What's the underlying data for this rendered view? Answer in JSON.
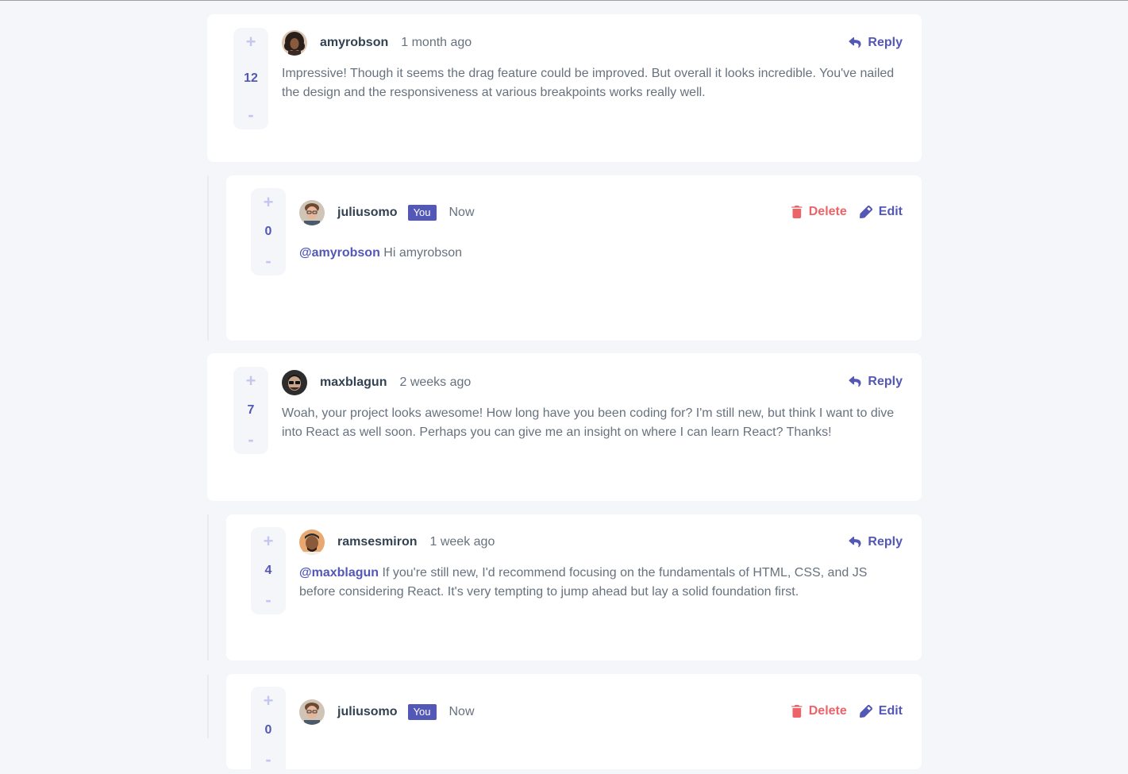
{
  "comments": [
    {
      "score": "12",
      "username": "amyrobson",
      "you": false,
      "time": "1 month ago",
      "mention": "",
      "text": "Impressive! Though it seems the drag feature could be improved. But overall it looks incredible. You've nailed the design and the responsiveness at various breakpoints works really well.",
      "actions": {
        "reply": "Reply"
      }
    },
    {
      "score": "0",
      "username": "juliusomo",
      "you": true,
      "you_label": "You",
      "time": "Now",
      "mention": "@amyrobson",
      "text": "Hi amyrobson",
      "actions": {
        "delete": "Delete",
        "edit": "Edit"
      }
    },
    {
      "score": "7",
      "username": "maxblagun",
      "you": false,
      "time": "2 weeks ago",
      "mention": "",
      "text": "Woah, your project looks awesome! How long have you been coding for? I'm still new, but think I want to dive into React as well soon. Perhaps you can give me an insight on where I can learn React? Thanks!",
      "actions": {
        "reply": "Reply"
      }
    },
    {
      "score": "4",
      "username": "ramsesmiron",
      "you": false,
      "time": "1 week ago",
      "mention": "@maxblagun",
      "text": "If you're still new, I'd recommend focusing on the fundamentals of HTML, CSS, and JS before considering React. It's very tempting to jump ahead but lay a solid foundation first.",
      "actions": {
        "reply": "Reply"
      }
    },
    {
      "score": "0",
      "username": "juliusomo",
      "you": true,
      "you_label": "You",
      "time": "Now",
      "mention": "",
      "text": "",
      "actions": {
        "delete": "Delete",
        "edit": "Edit"
      }
    }
  ],
  "vote": {
    "plus": "+",
    "minus": "-"
  },
  "icons": {
    "reply": "reply-arrow-icon",
    "delete": "trash-icon",
    "edit": "pencil-icon",
    "upvote": "plus-icon",
    "downvote": "minus-icon"
  },
  "colors": {
    "primary": "#5357b6",
    "danger": "#ed6368",
    "text": "#67727e",
    "heading": "#334253",
    "background": "#f5f6fa",
    "card": "#ffffff",
    "vote_icon": "#c5c6ef"
  }
}
